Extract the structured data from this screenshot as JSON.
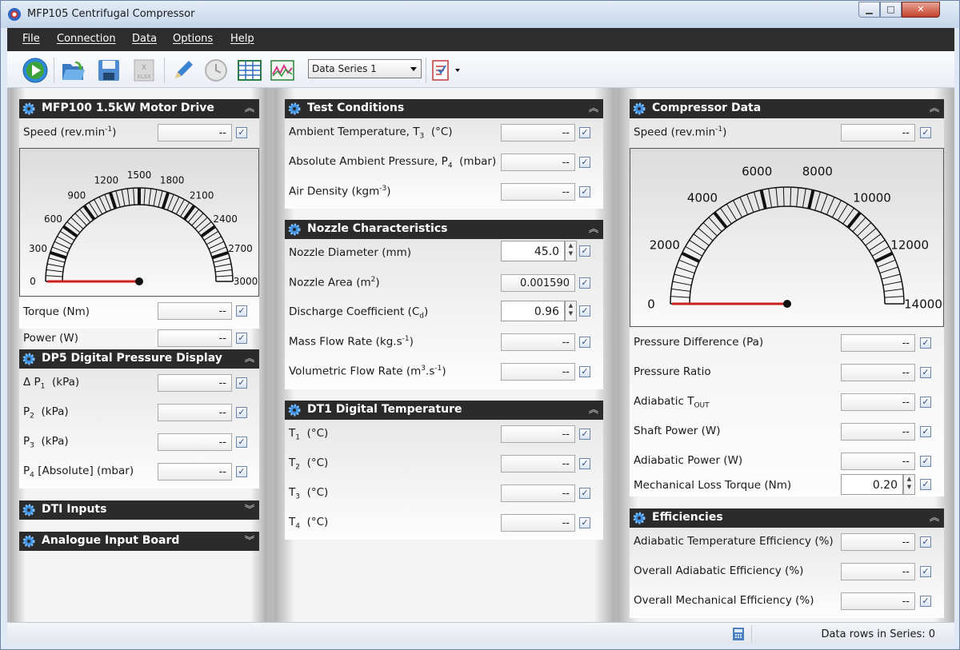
{
  "window": {
    "title": "MFP105 Centrifugal Compressor"
  },
  "menu": [
    "File",
    "Connection",
    "Data",
    "Options",
    "Help"
  ],
  "toolbar": {
    "series_select": "Data Series 1"
  },
  "motor": {
    "title": "MFP100 1.5kW Motor Drive",
    "speed_label": "Speed  (rev.min",
    "speed_value": "--",
    "dial_ticks": [
      "0",
      "300",
      "600",
      "900",
      "1200",
      "1500",
      "1800",
      "2100",
      "2400",
      "2700",
      "3000"
    ],
    "torque_label": "Torque  (Nm)",
    "torque_value": "--",
    "power_label": "Power  (W)",
    "power_value": "--"
  },
  "dp5": {
    "title": "DP5 Digital Pressure Display",
    "p1_label": "Δ P",
    "p1_unit": "(kPa)",
    "p1_value": "--",
    "p2_label": "P",
    "p2_unit": "(kPa)",
    "p2_value": "--",
    "p3_label": "P",
    "p3_unit": "(kPa)",
    "p3_value": "--",
    "p4_label": "P",
    "p4_unit": "[Absolute]  (mbar)",
    "p4_value": "--"
  },
  "dti": {
    "title": "DTI Inputs"
  },
  "analogue": {
    "title": "Analogue Input Board"
  },
  "test": {
    "title": "Test Conditions",
    "ambient_temp_label": "Ambient Temperature, T",
    "ambient_temp_unit": "(°C)",
    "ambient_temp_value": "--",
    "abs_pressure_label": "Absolute Ambient Pressure, P",
    "abs_pressure_unit": "(mbar)",
    "abs_pressure_value": "--",
    "air_density_label": "Air Density  (kgm",
    "air_density_value": "--"
  },
  "nozzle": {
    "title": "Nozzle Characteristics",
    "diameter_label": "Nozzle Diameter  (mm)",
    "diameter_value": "45.0",
    "area_label": "Nozzle Area  (m",
    "area_value": "0.001590",
    "cd_label": "Discharge Coefficient  (C",
    "cd_value": "0.96",
    "mass_flow_label": "Mass Flow Rate  (kg.s",
    "mass_flow_value": "--",
    "vol_flow_label": "Volumetric Flow Rate  (m",
    "vol_flow_value": "--"
  },
  "dt1": {
    "title": "DT1 Digital Temperature",
    "t1_value": "--",
    "t2_value": "--",
    "t3_value": "--",
    "t4_value": "--"
  },
  "compressor": {
    "title": "Compressor Data",
    "speed_label": "Speed  (rev.min",
    "speed_value": "--",
    "dial_ticks": [
      "0",
      "2000",
      "4000",
      "6000",
      "8000",
      "10000",
      "12000",
      "14000"
    ],
    "pressure_diff_label": "Pressure Difference  (Pa)",
    "pressure_diff_value": "--",
    "pressure_ratio_label": "Pressure Ratio",
    "pressure_ratio_value": "--",
    "adiabatic_tout_label": "Adiabatic T",
    "adiabatic_tout_value": "--",
    "shaft_power_label": "Shaft Power  (W)",
    "shaft_power_value": "--",
    "adiabatic_power_label": "Adiabatic Power  (W)",
    "adiabatic_power_value": "--",
    "mech_loss_label": "Mechanical Loss Torque  (Nm)",
    "mech_loss_value": "0.20"
  },
  "efficiencies": {
    "title": "Efficiencies",
    "ate_label": "Adiabatic Temperature Efficiency  (%)",
    "ate_value": "--",
    "oae_label": "Overall Adiabatic Efficiency  (%)",
    "oae_value": "--",
    "ome_label": "Overall Mechanical Efficiency  (%)",
    "ome_value": "--"
  },
  "status": {
    "rows_text": "Data rows in Series: 0"
  }
}
